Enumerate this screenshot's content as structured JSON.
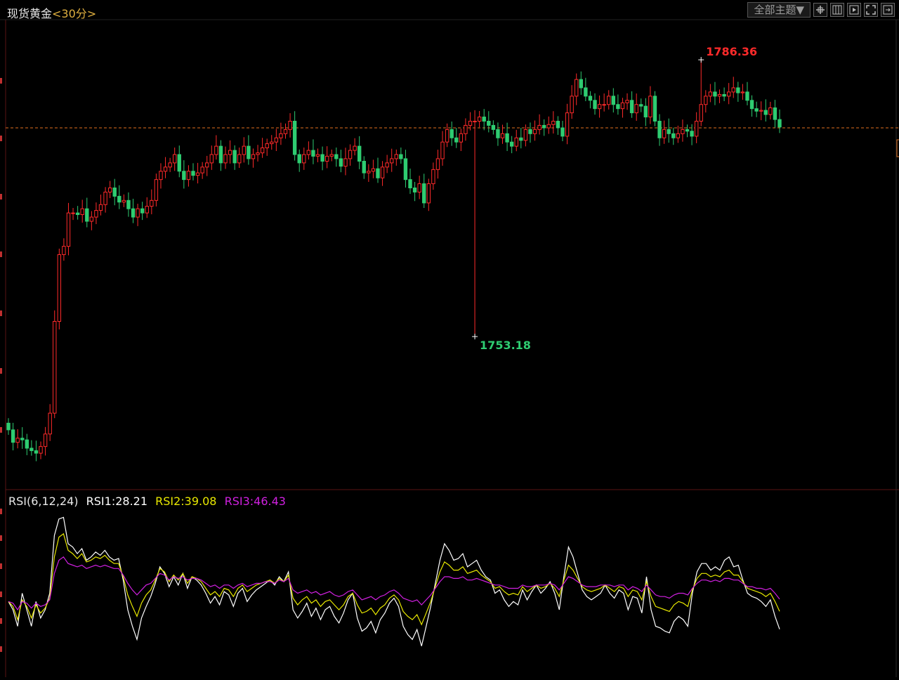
{
  "header": {
    "instrument": "现货黄金",
    "period": "<30分>",
    "theme_label": "全部主题▼"
  },
  "toolbar": {
    "icons": [
      "crosshair-icon",
      "window-icon",
      "play-icon",
      "fullscreen-icon",
      "expand-icon"
    ]
  },
  "colors": {
    "up": "#ff2a2a",
    "down": "#2ecc71",
    "rsi1": "#ffffff",
    "rsi2": "#e8e800",
    "rsi3": "#d020e0",
    "ref_line": "#e07020"
  },
  "rsi_legend": {
    "params": "RSI(6,12,24)",
    "rsi1": "RSI1:28.21",
    "rsi2": "RSI2:39.08",
    "rsi3": "RSI3:46.43"
  },
  "chart_data": [
    {
      "type": "candlestick",
      "timeframe": "30分",
      "x_count": 170,
      "ylim": [
        1735.0,
        1791.0
      ],
      "reference_price": 1778.2,
      "annotations": [
        {
          "label": "1786.36",
          "value": 1786.36,
          "kind": "high",
          "index": 150
        },
        {
          "label": "1753.18",
          "value": 1753.18,
          "kind": "low",
          "index": 101
        }
      ],
      "close_series": [
        1742,
        1740.5,
        1741,
        1740.8,
        1739.8,
        1739.5,
        1739.2,
        1740,
        1741.5,
        1744,
        1755,
        1763,
        1764,
        1768,
        1768,
        1767.8,
        1768.5,
        1767,
        1767.5,
        1768.3,
        1769,
        1770.5,
        1771,
        1770,
        1769.3,
        1769.5,
        1768.5,
        1767.5,
        1768.5,
        1768,
        1768.8,
        1769.5,
        1772,
        1773,
        1773.5,
        1774,
        1775,
        1773,
        1772,
        1773,
        1772.5,
        1772.8,
        1773.5,
        1774,
        1775,
        1776,
        1774,
        1775,
        1775.5,
        1774,
        1775,
        1776,
        1774.5,
        1775,
        1775.2,
        1775.8,
        1776.3,
        1776.5,
        1777,
        1777.5,
        1778,
        1779,
        1775,
        1774,
        1775,
        1775.5,
        1774.8,
        1775,
        1774.2,
        1774.8,
        1775,
        1774.5,
        1773.6,
        1774.5,
        1775.5,
        1776,
        1774.2,
        1772.8,
        1773,
        1773.3,
        1772.2,
        1773.5,
        1774,
        1774.5,
        1775,
        1774.5,
        1772,
        1771,
        1770.5,
        1771.5,
        1769.2,
        1771.5,
        1773.2,
        1774.5,
        1776.5,
        1778,
        1777,
        1776.5,
        1777.5,
        1778.5,
        1779,
        1779,
        1779.5,
        1779,
        1778.5,
        1778,
        1777,
        1777.5,
        1776.5,
        1776,
        1777,
        1776.7,
        1778,
        1777.5,
        1778,
        1778.5,
        1778.2,
        1778.6,
        1779,
        1778.2,
        1777.2,
        1780,
        1782,
        1784,
        1783,
        1782,
        1781.5,
        1780.5,
        1781,
        1781,
        1782,
        1781,
        1780.5,
        1781.2,
        1781.5,
        1780,
        1781,
        1780.8,
        1779.5,
        1782,
        1779,
        1777,
        1778,
        1777.5,
        1777,
        1777.5,
        1778,
        1777.8,
        1777.2,
        1779,
        1781,
        1782,
        1782.5,
        1782,
        1782.2,
        1782,
        1782.5,
        1783,
        1782.4,
        1782.5,
        1781.5,
        1780.5,
        1780.2,
        1780.3,
        1779.8,
        1780.6,
        1779.2,
        1778.3
      ],
      "ticks_on_axis_cut_off": true
    },
    {
      "type": "line",
      "title": "RSI(6,12,24)",
      "ylim": [
        0,
        100
      ],
      "series": [
        {
          "name": "RSI1",
          "last": 28.21,
          "values": [
            45,
            40,
            30,
            50,
            40,
            30,
            45,
            35,
            40,
            50,
            85,
            95,
            96,
            80,
            78,
            74,
            77,
            70,
            72,
            75,
            73,
            76,
            72,
            70,
            71,
            58,
            40,
            30,
            22,
            35,
            42,
            48,
            56,
            66,
            62,
            54,
            60,
            55,
            62,
            53,
            60,
            58,
            55,
            50,
            44,
            48,
            43,
            51,
            49,
            42,
            50,
            53,
            45,
            49,
            52,
            54,
            56,
            58,
            55,
            60,
            57,
            63,
            40,
            35,
            39,
            44,
            36,
            41,
            34,
            40,
            42,
            36,
            32,
            38,
            46,
            50,
            35,
            27,
            29,
            33,
            26,
            34,
            38,
            44,
            47,
            42,
            30,
            25,
            22,
            28,
            18,
            30,
            42,
            56,
            70,
            80,
            76,
            70,
            71,
            74,
            66,
            68,
            70,
            64,
            60,
            58,
            50,
            52,
            46,
            42,
            45,
            43,
            52,
            46,
            51,
            55,
            50,
            53,
            57,
            50,
            40,
            60,
            78,
            72,
            62,
            52,
            48,
            46,
            48,
            50,
            55,
            50,
            47,
            52,
            50,
            40,
            48,
            47,
            38,
            60,
            40,
            30,
            29,
            27,
            26,
            33,
            36,
            34,
            30,
            50,
            63,
            68,
            68,
            64,
            66,
            64,
            70,
            72,
            66,
            67,
            58,
            50,
            48,
            47,
            45,
            42,
            46,
            36,
            28.21
          ]
        },
        {
          "name": "RSI2",
          "last": 39.08,
          "values": [
            45,
            42,
            34,
            46,
            42,
            35,
            43,
            38,
            41,
            47,
            72,
            84,
            86,
            76,
            74,
            71,
            74,
            69,
            70,
            72,
            71,
            73,
            70,
            68,
            68,
            60,
            49,
            42,
            36,
            44,
            49,
            52,
            58,
            65,
            63,
            57,
            61,
            58,
            62,
            56,
            60,
            59,
            57,
            53,
            49,
            51,
            48,
            53,
            52,
            48,
            53,
            55,
            51,
            53,
            55,
            56,
            57,
            58,
            56,
            59,
            57,
            61,
            47,
            43,
            46,
            48,
            44,
            46,
            42,
            45,
            46,
            43,
            40,
            43,
            48,
            50,
            43,
            38,
            39,
            41,
            37,
            41,
            43,
            47,
            49,
            46,
            39,
            36,
            34,
            37,
            31,
            38,
            45,
            54,
            63,
            69,
            67,
            64,
            64,
            66,
            62,
            63,
            64,
            61,
            59,
            57,
            53,
            54,
            51,
            49,
            50,
            49,
            54,
            51,
            53,
            55,
            53,
            54,
            56,
            53,
            48,
            58,
            67,
            64,
            59,
            54,
            52,
            51,
            52,
            53,
            55,
            53,
            51,
            54,
            53,
            48,
            52,
            51,
            46,
            57,
            48,
            42,
            41,
            40,
            39,
            43,
            45,
            44,
            42,
            52,
            59,
            62,
            62,
            60,
            61,
            60,
            63,
            64,
            61,
            61,
            57,
            53,
            52,
            51,
            50,
            48,
            50,
            45,
            39.08
          ]
        },
        {
          "name": "RSI3",
          "last": 46.43,
          "values": [
            45,
            44,
            40,
            45,
            44,
            41,
            44,
            42,
            43,
            46,
            62,
            70,
            72,
            68,
            67,
            66,
            67,
            65,
            66,
            67,
            66,
            67,
            66,
            65,
            65,
            61,
            56,
            52,
            49,
            52,
            55,
            56,
            59,
            62,
            61,
            58,
            60,
            59,
            60,
            58,
            59,
            59,
            58,
            56,
            54,
            55,
            53,
            55,
            55,
            53,
            55,
            56,
            54,
            55,
            56,
            56,
            57,
            57,
            56,
            58,
            57,
            59,
            52,
            50,
            51,
            52,
            50,
            51,
            49,
            50,
            51,
            49,
            48,
            49,
            51,
            52,
            49,
            46,
            47,
            48,
            46,
            48,
            49,
            51,
            52,
            50,
            47,
            46,
            45,
            46,
            43,
            46,
            49,
            53,
            57,
            60,
            60,
            59,
            59,
            60,
            58,
            58,
            59,
            58,
            57,
            56,
            55,
            55,
            54,
            53,
            53,
            53,
            55,
            54,
            54,
            55,
            55,
            55,
            56,
            55,
            52,
            56,
            60,
            59,
            57,
            55,
            54,
            54,
            54,
            55,
            55,
            55,
            54,
            55,
            55,
            52,
            54,
            53,
            51,
            55,
            52,
            49,
            48,
            48,
            47,
            49,
            50,
            50,
            49,
            53,
            56,
            58,
            58,
            57,
            58,
            57,
            59,
            59,
            58,
            58,
            56,
            54,
            54,
            53,
            53,
            52,
            53,
            50,
            46.43
          ]
        }
      ]
    }
  ]
}
